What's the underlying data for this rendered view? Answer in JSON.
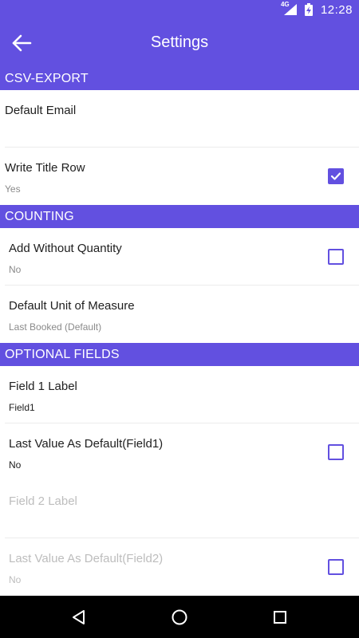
{
  "status_bar": {
    "network": "4G",
    "time": "12:28",
    "icons": [
      "signal-icon",
      "battery-charging-icon"
    ]
  },
  "app_bar": {
    "title": "Settings",
    "back_icon": "arrow-back-icon"
  },
  "theme": {
    "accent": "#6250e0"
  },
  "sections": {
    "csv_export": {
      "header": "CSV-EXPORT",
      "default_email": {
        "title": "Default Email",
        "summary": ""
      },
      "write_title_row": {
        "title": "Write Title Row",
        "summary": "Yes",
        "checked": true
      }
    },
    "counting": {
      "header": "COUNTING",
      "add_without_quantity": {
        "title": "Add Without Quantity",
        "summary": "No",
        "checked": false
      },
      "default_unit": {
        "title": "Default Unit of Measure",
        "summary": "Last Booked (Default)"
      }
    },
    "optional_fields": {
      "header": "OPTIONAL FIELDS",
      "field1_label": {
        "title": "Field 1 Label",
        "summary": "Field1"
      },
      "field1_default": {
        "title": "Last Value As Default(Field1)",
        "summary": "No",
        "checked": false
      },
      "field2_label": {
        "title": "Field 2 Label",
        "summary": "",
        "disabled": true
      },
      "field2_default": {
        "title": "Last Value As Default(Field2)",
        "summary": "No",
        "checked": false,
        "disabled": true
      }
    }
  },
  "nav_bar": {
    "icons": [
      "back-triangle-icon",
      "home-circle-icon",
      "recents-square-icon"
    ]
  }
}
